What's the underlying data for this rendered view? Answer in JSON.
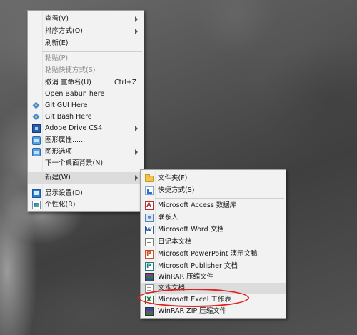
{
  "context_menu": {
    "items": [
      {
        "label": "查看(V)",
        "shortcut": "",
        "icon": "",
        "has_submenu": true,
        "disabled": false
      },
      {
        "label": "排序方式(O)",
        "shortcut": "",
        "icon": "",
        "has_submenu": true,
        "disabled": false
      },
      {
        "label": "刷新(E)",
        "shortcut": "",
        "icon": "",
        "has_submenu": false,
        "disabled": false
      },
      {
        "label": "粘贴(P)",
        "shortcut": "",
        "icon": "",
        "has_submenu": false,
        "disabled": true
      },
      {
        "label": "粘贴快捷方式(S)",
        "shortcut": "",
        "icon": "",
        "has_submenu": false,
        "disabled": true
      },
      {
        "label": "撤消 重命名(U)",
        "shortcut": "Ctrl+Z",
        "icon": "",
        "has_submenu": false,
        "disabled": false
      },
      {
        "label": "Open Babun here",
        "shortcut": "",
        "icon": "",
        "has_submenu": false,
        "disabled": false
      },
      {
        "label": "Git GUI Here",
        "shortcut": "",
        "icon": "git-icon",
        "has_submenu": false,
        "disabled": false
      },
      {
        "label": "Git Bash Here",
        "shortcut": "",
        "icon": "git-icon",
        "has_submenu": false,
        "disabled": false
      },
      {
        "label": "Adobe Drive CS4",
        "shortcut": "",
        "icon": "adobe-drive-icon",
        "has_submenu": true,
        "disabled": false
      },
      {
        "label": "图形属性......",
        "shortcut": "",
        "icon": "graphics-icon",
        "has_submenu": false,
        "disabled": false
      },
      {
        "label": "图形选项",
        "shortcut": "",
        "icon": "graphics-icon",
        "has_submenu": true,
        "disabled": false
      },
      {
        "label": "下一个桌面背景(N)",
        "shortcut": "",
        "icon": "",
        "has_submenu": false,
        "disabled": false
      },
      {
        "label": "新建(W)",
        "shortcut": "",
        "icon": "",
        "has_submenu": true,
        "disabled": false,
        "highlighted": true
      },
      {
        "label": "显示设置(D)",
        "shortcut": "",
        "icon": "display-settings-icon",
        "has_submenu": false,
        "disabled": false
      },
      {
        "label": "个性化(R)",
        "shortcut": "",
        "icon": "personalize-icon",
        "has_submenu": false,
        "disabled": false
      }
    ]
  },
  "new_submenu": {
    "items": [
      {
        "label": "文件夹(F)",
        "icon": "folder-icon"
      },
      {
        "label": "快捷方式(S)",
        "icon": "shortcut-icon"
      },
      {
        "label": "Microsoft Access 数据库",
        "icon": "access-icon"
      },
      {
        "label": "联系人",
        "icon": "contact-icon"
      },
      {
        "label": "Microsoft Word 文档",
        "icon": "word-icon"
      },
      {
        "label": "日记本文档",
        "icon": "journal-icon"
      },
      {
        "label": "Microsoft PowerPoint 演示文稿",
        "icon": "powerpoint-icon"
      },
      {
        "label": "Microsoft Publisher 文档",
        "icon": "publisher-icon"
      },
      {
        "label": "WinRAR 压缩文件",
        "icon": "winrar-icon"
      },
      {
        "label": "文本文档",
        "icon": "text-document-icon",
        "highlighted": true
      },
      {
        "label": "Microsoft Excel 工作表",
        "icon": "excel-icon"
      },
      {
        "label": "WinRAR ZIP 压缩文件",
        "icon": "winrar-zip-icon"
      }
    ]
  },
  "colors": {
    "menu_background": "#f2f2f2",
    "highlight": "#dcdcdc",
    "annotation": "#e0201c"
  }
}
